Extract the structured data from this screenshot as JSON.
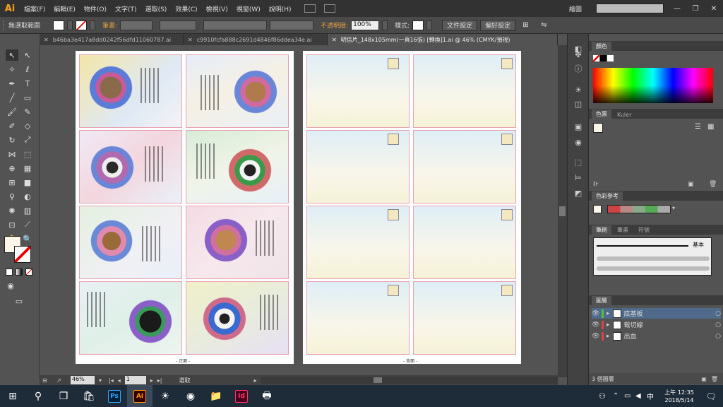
{
  "menubar": {
    "logo": "Ai",
    "items": [
      "檔案(F)",
      "編輯(E)",
      "物件(O)",
      "文字(T)",
      "選取(S)",
      "效果(C)",
      "檢視(V)",
      "視窗(W)",
      "說明(H)"
    ],
    "workspace": "繪圖",
    "search_placeholder": ""
  },
  "control_bar": {
    "selection": "無選取範圍",
    "stroke_label": "筆畫:",
    "opacity_label": "不透明度:",
    "opacity_value": "100%",
    "style_label": "樣式:",
    "doc_setup": "文件設定",
    "preferences": "偏好設定"
  },
  "tabs": [
    {
      "label": "b46ba3e417a8dd0242f56dfd11060787.ai",
      "active": false
    },
    {
      "label": "c9910fcfa888c2691d4846f86ddea34e.ai",
      "active": false
    },
    {
      "label": "明信片_148x105mm(一頁16張) [轉換]1.ai @ 46% (CMYK/預視)",
      "active": true
    }
  ],
  "artboards": {
    "front_label": "- 正面 -",
    "back_label": "- 背面 -",
    "front_big": "正面",
    "back_big": "背面"
  },
  "status": {
    "zoom": "46%",
    "page": "1",
    "mode": "選取"
  },
  "panels": {
    "color_title": "顏色",
    "swatch_tabs": [
      "色票",
      "Kuler"
    ],
    "color_guide_title": "色彩參考",
    "brush_tabs": [
      "筆刷",
      "筆畫",
      "符號"
    ],
    "brush_basic": "基本",
    "layers_title": "圖層",
    "layers": [
      {
        "name": "底基板",
        "color": "#4fc33a",
        "selected": true
      },
      {
        "name": "裁切線",
        "color": "#e04040",
        "selected": false
      },
      {
        "name": "出血",
        "color": "#e04040",
        "selected": false
      }
    ],
    "layer_count": "3 個圖層"
  },
  "taskbar": {
    "time": "上午 12:35",
    "date": "2018/5/14",
    "ime": "中",
    "apps": [
      {
        "name": "Ps",
        "color": "#31a8ff",
        "bg": "#001e36"
      },
      {
        "name": "Ai",
        "color": "#ff9a00",
        "bg": "#330000"
      },
      {
        "name": "Id",
        "color": "#ff3366",
        "bg": "#49021f"
      }
    ]
  }
}
